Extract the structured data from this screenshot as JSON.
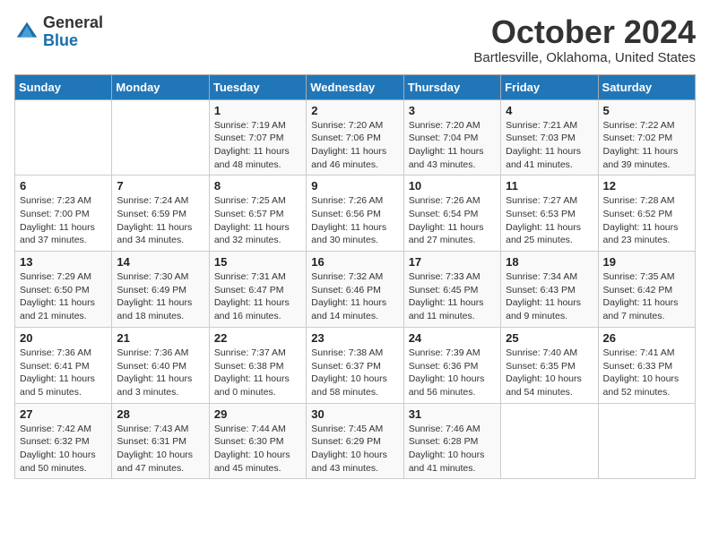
{
  "header": {
    "logo_general": "General",
    "logo_blue": "Blue",
    "month_title": "October 2024",
    "location": "Bartlesville, Oklahoma, United States"
  },
  "days_of_week": [
    "Sunday",
    "Monday",
    "Tuesday",
    "Wednesday",
    "Thursday",
    "Friday",
    "Saturday"
  ],
  "weeks": [
    [
      {
        "num": "",
        "info": ""
      },
      {
        "num": "",
        "info": ""
      },
      {
        "num": "1",
        "info": "Sunrise: 7:19 AM\nSunset: 7:07 PM\nDaylight: 11 hours and 48 minutes."
      },
      {
        "num": "2",
        "info": "Sunrise: 7:20 AM\nSunset: 7:06 PM\nDaylight: 11 hours and 46 minutes."
      },
      {
        "num": "3",
        "info": "Sunrise: 7:20 AM\nSunset: 7:04 PM\nDaylight: 11 hours and 43 minutes."
      },
      {
        "num": "4",
        "info": "Sunrise: 7:21 AM\nSunset: 7:03 PM\nDaylight: 11 hours and 41 minutes."
      },
      {
        "num": "5",
        "info": "Sunrise: 7:22 AM\nSunset: 7:02 PM\nDaylight: 11 hours and 39 minutes."
      }
    ],
    [
      {
        "num": "6",
        "info": "Sunrise: 7:23 AM\nSunset: 7:00 PM\nDaylight: 11 hours and 37 minutes."
      },
      {
        "num": "7",
        "info": "Sunrise: 7:24 AM\nSunset: 6:59 PM\nDaylight: 11 hours and 34 minutes."
      },
      {
        "num": "8",
        "info": "Sunrise: 7:25 AM\nSunset: 6:57 PM\nDaylight: 11 hours and 32 minutes."
      },
      {
        "num": "9",
        "info": "Sunrise: 7:26 AM\nSunset: 6:56 PM\nDaylight: 11 hours and 30 minutes."
      },
      {
        "num": "10",
        "info": "Sunrise: 7:26 AM\nSunset: 6:54 PM\nDaylight: 11 hours and 27 minutes."
      },
      {
        "num": "11",
        "info": "Sunrise: 7:27 AM\nSunset: 6:53 PM\nDaylight: 11 hours and 25 minutes."
      },
      {
        "num": "12",
        "info": "Sunrise: 7:28 AM\nSunset: 6:52 PM\nDaylight: 11 hours and 23 minutes."
      }
    ],
    [
      {
        "num": "13",
        "info": "Sunrise: 7:29 AM\nSunset: 6:50 PM\nDaylight: 11 hours and 21 minutes."
      },
      {
        "num": "14",
        "info": "Sunrise: 7:30 AM\nSunset: 6:49 PM\nDaylight: 11 hours and 18 minutes."
      },
      {
        "num": "15",
        "info": "Sunrise: 7:31 AM\nSunset: 6:47 PM\nDaylight: 11 hours and 16 minutes."
      },
      {
        "num": "16",
        "info": "Sunrise: 7:32 AM\nSunset: 6:46 PM\nDaylight: 11 hours and 14 minutes."
      },
      {
        "num": "17",
        "info": "Sunrise: 7:33 AM\nSunset: 6:45 PM\nDaylight: 11 hours and 11 minutes."
      },
      {
        "num": "18",
        "info": "Sunrise: 7:34 AM\nSunset: 6:43 PM\nDaylight: 11 hours and 9 minutes."
      },
      {
        "num": "19",
        "info": "Sunrise: 7:35 AM\nSunset: 6:42 PM\nDaylight: 11 hours and 7 minutes."
      }
    ],
    [
      {
        "num": "20",
        "info": "Sunrise: 7:36 AM\nSunset: 6:41 PM\nDaylight: 11 hours and 5 minutes."
      },
      {
        "num": "21",
        "info": "Sunrise: 7:36 AM\nSunset: 6:40 PM\nDaylight: 11 hours and 3 minutes."
      },
      {
        "num": "22",
        "info": "Sunrise: 7:37 AM\nSunset: 6:38 PM\nDaylight: 11 hours and 0 minutes."
      },
      {
        "num": "23",
        "info": "Sunrise: 7:38 AM\nSunset: 6:37 PM\nDaylight: 10 hours and 58 minutes."
      },
      {
        "num": "24",
        "info": "Sunrise: 7:39 AM\nSunset: 6:36 PM\nDaylight: 10 hours and 56 minutes."
      },
      {
        "num": "25",
        "info": "Sunrise: 7:40 AM\nSunset: 6:35 PM\nDaylight: 10 hours and 54 minutes."
      },
      {
        "num": "26",
        "info": "Sunrise: 7:41 AM\nSunset: 6:33 PM\nDaylight: 10 hours and 52 minutes."
      }
    ],
    [
      {
        "num": "27",
        "info": "Sunrise: 7:42 AM\nSunset: 6:32 PM\nDaylight: 10 hours and 50 minutes."
      },
      {
        "num": "28",
        "info": "Sunrise: 7:43 AM\nSunset: 6:31 PM\nDaylight: 10 hours and 47 minutes."
      },
      {
        "num": "29",
        "info": "Sunrise: 7:44 AM\nSunset: 6:30 PM\nDaylight: 10 hours and 45 minutes."
      },
      {
        "num": "30",
        "info": "Sunrise: 7:45 AM\nSunset: 6:29 PM\nDaylight: 10 hours and 43 minutes."
      },
      {
        "num": "31",
        "info": "Sunrise: 7:46 AM\nSunset: 6:28 PM\nDaylight: 10 hours and 41 minutes."
      },
      {
        "num": "",
        "info": ""
      },
      {
        "num": "",
        "info": ""
      }
    ]
  ]
}
